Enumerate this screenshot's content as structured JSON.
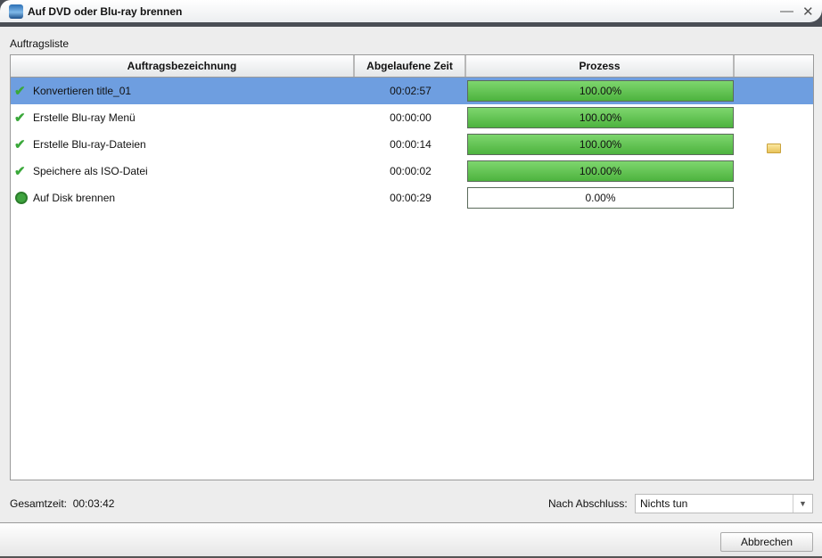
{
  "window": {
    "title": "Auf DVD oder Blu-ray brennen",
    "minimize": "—",
    "close": "✕"
  },
  "list_label": "Auftragsliste",
  "columns": [
    "Auftragsbezeichnung",
    "Abgelaufene Zeit",
    "Prozess",
    ""
  ],
  "rows": [
    {
      "name": "Konvertieren title_01",
      "time": "00:02:57",
      "progress": "100.00%",
      "progress_value": 100,
      "status": "done",
      "selected": true
    },
    {
      "name": "Erstelle Blu-ray Menü",
      "time": "00:00:00",
      "progress": "100.00%",
      "progress_value": 100,
      "status": "done"
    },
    {
      "name": "Erstelle Blu-ray-Dateien",
      "time": "00:00:14",
      "progress": "100.00%",
      "progress_value": 100,
      "status": "done",
      "folder": true
    },
    {
      "name": "Speichere als ISO-Datei",
      "time": "00:00:02",
      "progress": "100.00%",
      "progress_value": 100,
      "status": "done"
    },
    {
      "name": "Auf Disk brennen",
      "time": "00:00:29",
      "progress": "0.00%",
      "progress_value": 0,
      "status": "running"
    }
  ],
  "footer": {
    "total_label": "Gesamtzeit:",
    "total_value": "00:03:42",
    "after_label": "Nach Abschluss:",
    "after_value": "Nichts tun",
    "cancel": "Abbrechen"
  }
}
